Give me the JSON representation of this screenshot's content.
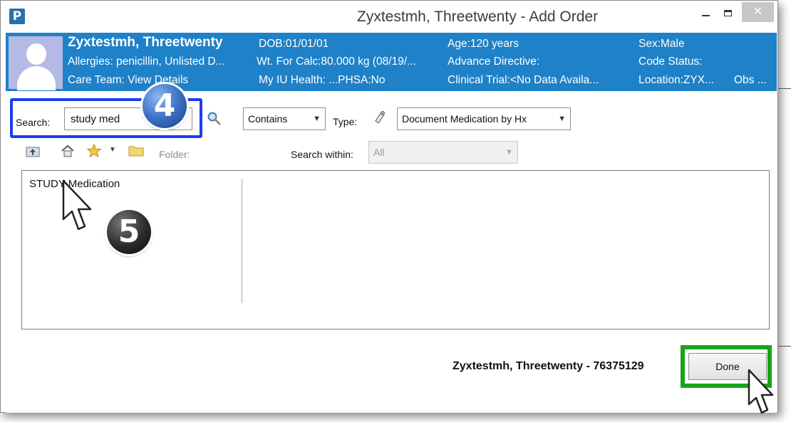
{
  "window": {
    "app_icon": "P",
    "title": "Zyxtestmh, Threetwenty - Add Order",
    "minimize_glyph": "–",
    "close_glyph": "✕"
  },
  "banner": {
    "patient_name": "Zyxtestmh, Threetwenty",
    "dob": "DOB:01/01/01",
    "age": "Age:120 years",
    "sex": "Sex:Male",
    "allergies": "Allergies: penicillin, Unlisted D...",
    "weight": "Wt. For Calc:80.000 kg (08/19/...",
    "advance_directive": "Advance Directive:",
    "code_status": "Code Status:",
    "care_team_label": "Care Team: ",
    "care_team_link": "View Details",
    "my_iu_health": "My IU Health: ...PHSA:No",
    "clinical_trial": "Clinical Trial:<No Data Availa...",
    "location": "Location:ZYX...",
    "obs": "Obs ..."
  },
  "search": {
    "label": "Search:",
    "value": "study med",
    "mode": "Contains",
    "type_label": "Type:",
    "type_value": "Document Medication by Hx"
  },
  "toolbar": {
    "folder_label": "Folder:",
    "search_within_label": "Search within:",
    "search_within_value": "All"
  },
  "results": {
    "items": [
      "STUDY Medication"
    ]
  },
  "footer": {
    "patient_id_text": "Zyxtestmh, Threetwenty - 76375129",
    "done_label": "Done"
  },
  "annotations": {
    "step_4": "4",
    "step_5": "5",
    "search_box_color": "#1c3cf5",
    "done_box_color": "#1aa31a"
  },
  "colors": {
    "banner_bg": "#1f81c7",
    "avatar_bg": "#b5b9e6"
  }
}
